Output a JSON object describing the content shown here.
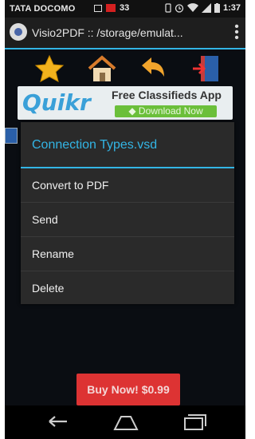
{
  "status_bar": {
    "carrier": "TATA DOCOMO",
    "notification_count": "33",
    "time": "1:37"
  },
  "app_bar": {
    "title": "Visio2PDF :: /storage/emulat..."
  },
  "toolbar": {
    "icons": [
      "star-icon",
      "home-icon",
      "back-arrow-icon",
      "exit-door-icon"
    ]
  },
  "ad_banner": {
    "logo": "Quikr",
    "headline": "Free Classifieds App",
    "cta": "Download Now"
  },
  "dialog": {
    "title": "Connection Types.vsd",
    "items": [
      {
        "label": "Convert to PDF"
      },
      {
        "label": "Send"
      },
      {
        "label": "Rename"
      },
      {
        "label": "Delete"
      }
    ]
  },
  "footer": {
    "buy_button": "Buy Now! $0.99"
  },
  "colors": {
    "accent": "#33b5e5",
    "buy_button": "#dd3333",
    "ad_cta": "#6bbf3a"
  }
}
